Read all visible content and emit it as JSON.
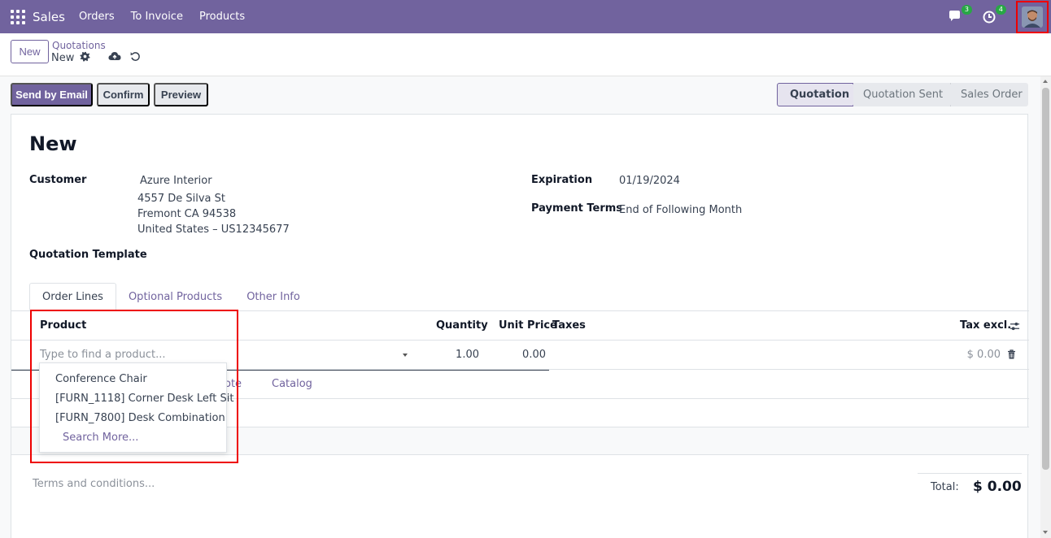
{
  "navbar": {
    "app_name": "Sales",
    "menu": [
      "Orders",
      "To Invoice",
      "Products"
    ],
    "chat_badge": "3",
    "activity_badge": "4",
    "icons": {
      "apps": "apps-grid-icon",
      "chat": "chat-icon",
      "activity": "clock-icon",
      "avatar": "user-avatar"
    },
    "accent_color": "#71639e"
  },
  "control_panel": {
    "new_label": "New",
    "breadcrumb_parent": "Quotations",
    "breadcrumb_current": "New",
    "icons": {
      "settings": "gear-icon",
      "save": "cloud-upload-icon",
      "discard": "undo-icon"
    }
  },
  "actions": {
    "send_email": "Send by Email",
    "confirm": "Confirm",
    "preview": "Preview"
  },
  "status_stages": [
    {
      "label": "Quotation",
      "active": true
    },
    {
      "label": "Quotation Sent",
      "active": false
    },
    {
      "label": "Sales Order",
      "active": false
    }
  ],
  "form": {
    "title": "New",
    "customer_label": "Customer",
    "customer_name": "Azure Interior",
    "address_line1": "4557 De Silva St",
    "address_line2": "Fremont CA 94538",
    "address_line3": "United States – US12345677",
    "template_label": "Quotation Template",
    "expiration_label": "Expiration",
    "expiration_value": "01/19/2024",
    "payment_terms_label": "Payment Terms",
    "payment_terms_value": "End of Following Month"
  },
  "tabs": [
    "Order Lines",
    "Optional Products",
    "Other Info"
  ],
  "table": {
    "headers": {
      "product": "Product",
      "quantity": "Quantity",
      "unit_price": "Unit Price",
      "taxes": "Taxes",
      "tax_excl": "Tax excl."
    },
    "edit_row": {
      "product_placeholder": "Type to find a product...",
      "quantity": "1.00",
      "unit_price": "0.00",
      "subtotal": "$ 0.00"
    },
    "add_links": {
      "note_fragment": "ote",
      "catalog": "Catalog"
    }
  },
  "autocomplete": {
    "items": [
      "Conference Chair",
      "[FURN_1118] Corner Desk Left Sit",
      "[FURN_7800] Desk Combination"
    ],
    "search_more": "Search More..."
  },
  "footer": {
    "terms_placeholder": "Terms and conditions...",
    "total_label": "Total:",
    "total_value": "$ 0.00"
  }
}
